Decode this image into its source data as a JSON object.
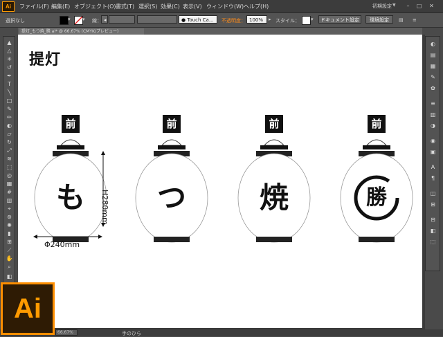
{
  "app": {
    "logo_text": "Ai"
  },
  "menu": {
    "items": [
      "ファイル(F)",
      "編集(E)",
      "オブジェクト(O)",
      "書式(T)",
      "選択(S)",
      "効果(C)",
      "表示(V)",
      "ウィンドウ(W)",
      "ヘルプ(H)"
    ],
    "workspace": "初期設定"
  },
  "options_bar": {
    "selection": "選択なし",
    "stroke_label": "線：",
    "style_font": "Touch Ca...",
    "opacity_label": "不透明度：",
    "opacity_value": "100%",
    "style_label": "スタイル：",
    "doc_settings": "ドキュメント設定",
    "env_settings": "環境設定",
    "colors": {
      "fill": "#000000",
      "opacity_label": "#ff8c1a"
    }
  },
  "document": {
    "tab_title": "提灯_もつ焼_勝.ai* @ 66.67% (CMYK/プレビュー)"
  },
  "artboard": {
    "title": "提灯",
    "lanterns": [
      {
        "label": "前",
        "kanji": "も"
      },
      {
        "label": "前",
        "kanji": "つ"
      },
      {
        "label": "前",
        "kanji": "焼"
      },
      {
        "label": "前",
        "kanji": "勝"
      }
    ],
    "height_dim": "H280mm",
    "width_dim": "Φ240mm"
  },
  "status": {
    "tool": "手のひら",
    "zoom": "66.67%"
  },
  "badge": {
    "text": "Ai"
  }
}
